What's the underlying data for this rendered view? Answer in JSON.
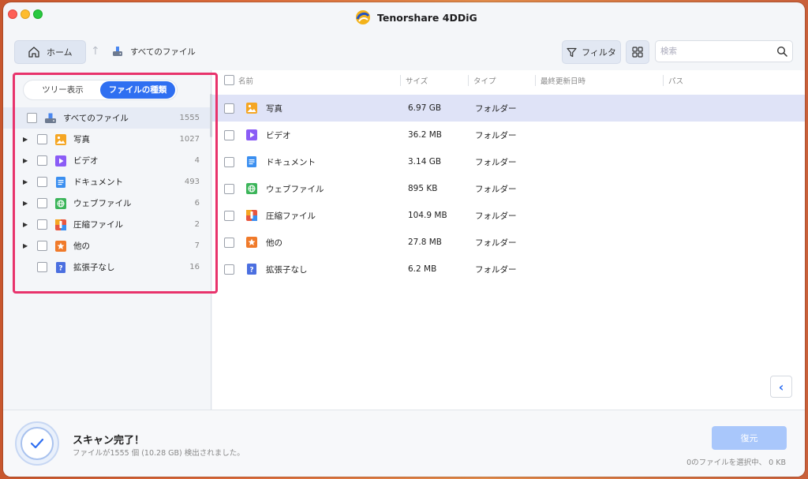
{
  "window": {
    "title": "Tenorshare 4DDiG"
  },
  "toolbar": {
    "home_label": "ホーム",
    "breadcrumb": "すべてのファイル",
    "filter_label": "フィルタ",
    "search_placeholder": "検索"
  },
  "sidebar": {
    "tabs": [
      {
        "label": "ツリー表示",
        "active": false
      },
      {
        "label": "ファイルの種類",
        "active": true
      }
    ],
    "items": [
      {
        "label": "すべてのファイル",
        "count": "1555",
        "icon": "drive-icon",
        "expandable": false,
        "selected": true
      },
      {
        "label": "写真",
        "count": "1027",
        "icon": "photo-icon",
        "expandable": true
      },
      {
        "label": "ビデオ",
        "count": "4",
        "icon": "video-icon",
        "expandable": true
      },
      {
        "label": "ドキュメント",
        "count": "493",
        "icon": "document-icon",
        "expandable": true
      },
      {
        "label": "ウェブファイル",
        "count": "6",
        "icon": "web-icon",
        "expandable": true
      },
      {
        "label": "圧縮ファイル",
        "count": "2",
        "icon": "archive-icon",
        "expandable": true
      },
      {
        "label": "他の",
        "count": "7",
        "icon": "other-icon",
        "expandable": true
      },
      {
        "label": "拡張子なし",
        "count": "16",
        "icon": "unknown-icon",
        "expandable": false
      }
    ]
  },
  "table": {
    "columns": [
      "名前",
      "サイズ",
      "タイプ",
      "最終更新日時",
      "パス"
    ],
    "rows": [
      {
        "name": "写真",
        "size": "6.97 GB",
        "type": "フォルダー",
        "icon": "photo-icon",
        "selected": true
      },
      {
        "name": "ビデオ",
        "size": "36.2 MB",
        "type": "フォルダー",
        "icon": "video-icon"
      },
      {
        "name": "ドキュメント",
        "size": "3.14 GB",
        "type": "フォルダー",
        "icon": "document-icon"
      },
      {
        "name": "ウェブファイル",
        "size": "895 KB",
        "type": "フォルダー",
        "icon": "web-icon"
      },
      {
        "name": "圧縮ファイル",
        "size": "104.9 MB",
        "type": "フォルダー",
        "icon": "archive-icon"
      },
      {
        "name": "他の",
        "size": "27.8 MB",
        "type": "フォルダー",
        "icon": "other-icon"
      },
      {
        "name": "拡張子なし",
        "size": "6.2 MB",
        "type": "フォルダー",
        "icon": "unknown-icon"
      }
    ]
  },
  "footer": {
    "scan_title": "スキャン完了！",
    "scan_summary": "ファイルが1555 個 (10.28 GB) 検出されました。",
    "recover_label": "復元",
    "selection_info": "0のファイルを選択中、 0 KB"
  },
  "colors": {
    "accent": "#2f6ff1",
    "highlight": "#e8336c",
    "selected_row": "#dfe3f7",
    "photo": "#f5a623",
    "video": "#8b5cf6",
    "document": "#3b8ff0",
    "web": "#3cb55a",
    "archive": "#e8563f",
    "other": "#f07a2a",
    "unknown": "#4b6fe0"
  }
}
